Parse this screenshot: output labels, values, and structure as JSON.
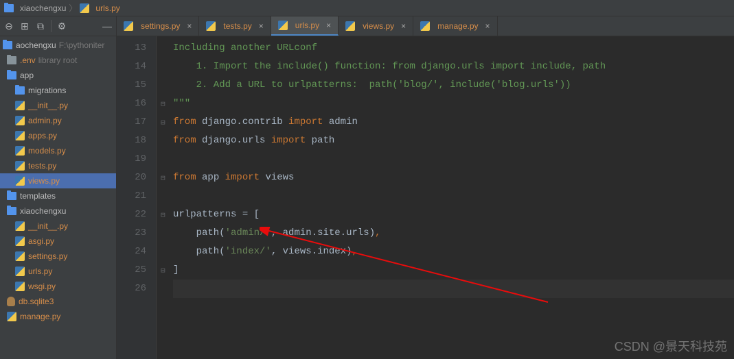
{
  "breadcrumb": {
    "folder": "xiaochengxu",
    "file": "urls.py"
  },
  "toolbar": {
    "collapse": "⎘",
    "show_modules": "⧉",
    "select": "⇱",
    "settings": "⚙",
    "hide": "—"
  },
  "tree": {
    "root": {
      "name": "aochengxu",
      "path": "F:\\pythoniter"
    },
    "items": [
      {
        "indent": 6,
        "type": "folder",
        "label": ".env",
        "extra": "library root",
        "color": "orange"
      },
      {
        "indent": 6,
        "type": "folder-proj",
        "label": "app"
      },
      {
        "indent": 18,
        "type": "folder-proj",
        "label": "migrations"
      },
      {
        "indent": 18,
        "type": "py",
        "label": "__init__.py",
        "color": "orange"
      },
      {
        "indent": 18,
        "type": "py",
        "label": "admin.py",
        "color": "orange"
      },
      {
        "indent": 18,
        "type": "py",
        "label": "apps.py",
        "color": "orange"
      },
      {
        "indent": 18,
        "type": "py",
        "label": "models.py",
        "color": "orange"
      },
      {
        "indent": 18,
        "type": "py",
        "label": "tests.py",
        "color": "orange"
      },
      {
        "indent": 18,
        "type": "py",
        "label": "views.py",
        "color": "orange",
        "selected": true
      },
      {
        "indent": 6,
        "type": "folder-proj",
        "label": "templates"
      },
      {
        "indent": 6,
        "type": "folder-proj",
        "label": "xiaochengxu"
      },
      {
        "indent": 18,
        "type": "py",
        "label": "__init__.py",
        "color": "orange"
      },
      {
        "indent": 18,
        "type": "py",
        "label": "asgi.py",
        "color": "orange"
      },
      {
        "indent": 18,
        "type": "py",
        "label": "settings.py",
        "color": "orange"
      },
      {
        "indent": 18,
        "type": "py",
        "label": "urls.py",
        "color": "orange"
      },
      {
        "indent": 18,
        "type": "py",
        "label": "wsgi.py",
        "color": "orange"
      },
      {
        "indent": 6,
        "type": "db",
        "label": "db.sqlite3",
        "color": "orange"
      },
      {
        "indent": 6,
        "type": "py",
        "label": "manage.py",
        "color": "orange"
      }
    ]
  },
  "tabs": [
    {
      "label": "settings.py",
      "color": "orange"
    },
    {
      "label": "tests.py",
      "color": "orange"
    },
    {
      "label": "urls.py",
      "color": "orange",
      "active": true
    },
    {
      "label": "views.py",
      "color": "orange"
    },
    {
      "label": "manage.py",
      "color": "orange"
    }
  ],
  "editor": {
    "startLine": 13,
    "lines": [
      {
        "n": 13,
        "tokens": [
          {
            "t": "Including another URLconf",
            "c": "docstr"
          }
        ]
      },
      {
        "n": 14,
        "tokens": [
          {
            "t": "    1. Import the include() function: from django.urls import include, path",
            "c": "docstr"
          }
        ]
      },
      {
        "n": 15,
        "tokens": [
          {
            "t": "    2. Add a URL to urlpatterns:  path('blog/', include('blog.urls'))",
            "c": "docstr"
          }
        ]
      },
      {
        "n": 16,
        "fold": "end",
        "tokens": [
          {
            "t": "\"\"\"",
            "c": "docstr"
          }
        ]
      },
      {
        "n": 17,
        "fold": "start",
        "tokens": [
          {
            "t": "from ",
            "c": "kw"
          },
          {
            "t": "django.contrib ",
            "c": "fn"
          },
          {
            "t": "import ",
            "c": "kw"
          },
          {
            "t": "admin",
            "c": "fn"
          }
        ]
      },
      {
        "n": 18,
        "tokens": [
          {
            "t": "from ",
            "c": "kw"
          },
          {
            "t": "django.urls ",
            "c": "fn"
          },
          {
            "t": "import ",
            "c": "kw"
          },
          {
            "t": "path",
            "c": "fn"
          }
        ]
      },
      {
        "n": 19,
        "tokens": []
      },
      {
        "n": 20,
        "fold": "end",
        "tokens": [
          {
            "t": "from ",
            "c": "kw"
          },
          {
            "t": "app ",
            "c": "fn"
          },
          {
            "t": "import ",
            "c": "kw"
          },
          {
            "t": "views",
            "c": "fn"
          }
        ]
      },
      {
        "n": 21,
        "tokens": []
      },
      {
        "n": 22,
        "fold": "start",
        "tokens": [
          {
            "t": "urlpatterns = [",
            "c": "fn"
          }
        ]
      },
      {
        "n": 23,
        "tokens": [
          {
            "t": "    path(",
            "c": "fn"
          },
          {
            "t": "'admin/'",
            "c": "str"
          },
          {
            "t": ", ",
            "c": "fn"
          },
          {
            "t": "admin.site.urls",
            "c": "fn"
          },
          {
            "t": ")",
            "c": "fn"
          },
          {
            "t": ",",
            "c": "kw"
          }
        ]
      },
      {
        "n": 24,
        "tokens": [
          {
            "t": "    path(",
            "c": "fn"
          },
          {
            "t": "'index/'",
            "c": "str"
          },
          {
            "t": ", ",
            "c": "fn"
          },
          {
            "t": "views.index",
            "c": "fn"
          },
          {
            "t": ")",
            "c": "fn"
          },
          {
            "t": ",",
            "c": "kw"
          }
        ]
      },
      {
        "n": 25,
        "fold": "end",
        "tokens": [
          {
            "t": "]",
            "c": "fn"
          }
        ]
      },
      {
        "n": 26,
        "current": true,
        "tokens": []
      }
    ]
  },
  "watermark": "CSDN @景天科技苑"
}
